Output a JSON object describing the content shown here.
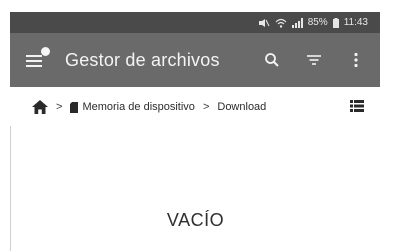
{
  "status_bar": {
    "battery": "85%",
    "time": "11:43"
  },
  "app_bar": {
    "title": "Gestor de archivos",
    "menu_icon": "hamburger-menu-icon",
    "actions": [
      "search-icon",
      "filter-icon",
      "more-vert-icon"
    ]
  },
  "breadcrumb": {
    "home_icon": "home-icon",
    "storage_label": "Memoria de dispositivo",
    "folder_label": "Download",
    "separator": ">",
    "view_icon": "list-view-icon"
  },
  "content": {
    "empty_label": "VACÍO"
  },
  "colors": {
    "status_bar_bg": "#4a4a4a",
    "app_bar_bg": "#6a6a6a",
    "page_bg": "#ffffff"
  }
}
